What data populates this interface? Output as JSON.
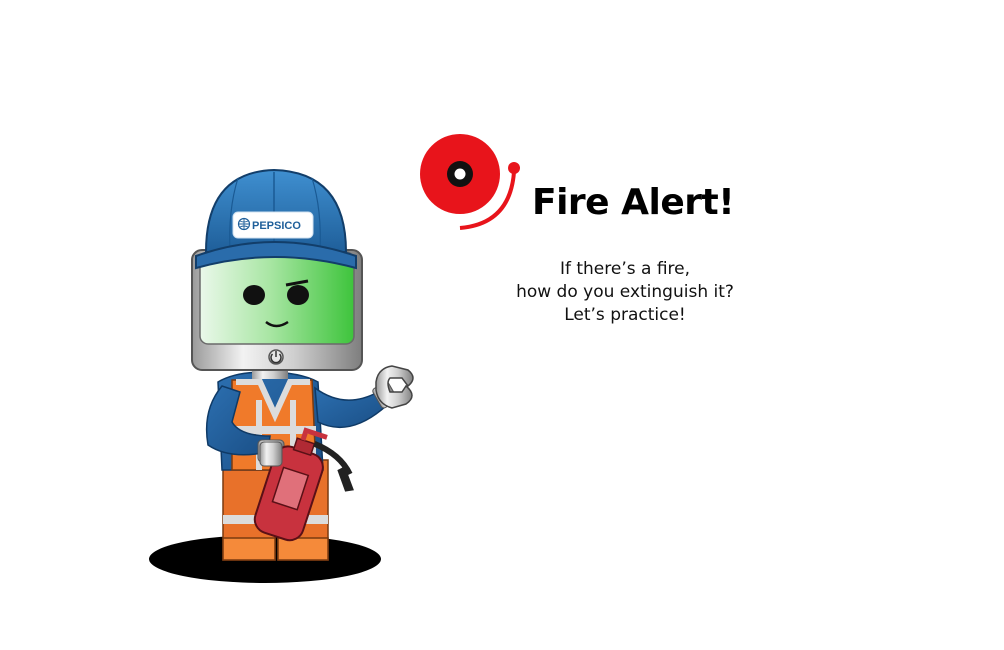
{
  "scene": {
    "title": "Fire Alert!",
    "message_lines": [
      "If there’s a fire,",
      "how do you extinguish it?",
      "Let’s practice!"
    ],
    "cap_logo_text": "PEPSICO"
  },
  "icons": {
    "alarm": "fire-alarm-bell-icon",
    "power": "power-icon",
    "logo": "pepsico-globe-icon"
  },
  "colors": {
    "alarm_red": "#e8141b",
    "cap_blue": "#2f78b8",
    "screen_green": "#4cc94a",
    "vest_orange": "#f07a2a",
    "extinguisher_red": "#c8323e"
  }
}
